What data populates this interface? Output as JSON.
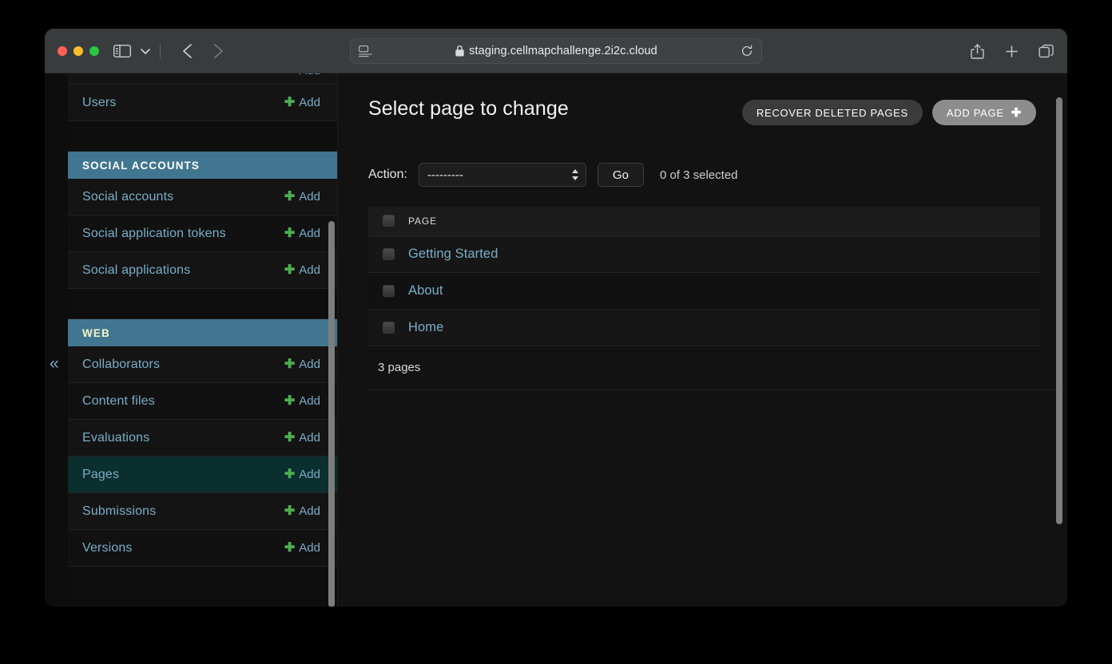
{
  "browser": {
    "url": "staging.cellmapchallenge.2i2c.cloud",
    "traffic_lights": [
      "close",
      "minimize",
      "zoom"
    ],
    "icons": {
      "sidebar_toggle": "sidebar-toggle-icon",
      "tab_group_chevron": "chevron-down-icon",
      "back": "back-arrow-icon",
      "forward": "forward-arrow-icon",
      "reader": "reader-view-icon",
      "lock": "lock-icon",
      "reload": "reload-icon",
      "share": "share-icon",
      "new_tab": "plus-icon",
      "tab_overview": "tab-overview-icon"
    }
  },
  "sidebar": {
    "collapse_glyph": "«",
    "partial_top_row": {
      "label": "",
      "add_label": "Add"
    },
    "blocks": [
      {
        "type": "item",
        "label": "Users",
        "add_label": "Add",
        "current": false
      },
      {
        "type": "gap"
      },
      {
        "type": "section",
        "label": "SOCIAL ACCOUNTS",
        "visited": false
      },
      {
        "type": "item",
        "label": "Social accounts",
        "add_label": "Add",
        "current": false
      },
      {
        "type": "item",
        "label": "Social application tokens",
        "add_label": "Add",
        "current": false
      },
      {
        "type": "item",
        "label": "Social applications",
        "add_label": "Add",
        "current": false
      },
      {
        "type": "gap"
      },
      {
        "type": "section",
        "label": "WEB",
        "visited": true
      },
      {
        "type": "item",
        "label": "Collaborators",
        "add_label": "Add",
        "current": false
      },
      {
        "type": "item",
        "label": "Content files",
        "add_label": "Add",
        "current": false
      },
      {
        "type": "item",
        "label": "Evaluations",
        "add_label": "Add",
        "current": false
      },
      {
        "type": "item",
        "label": "Pages",
        "add_label": "Add",
        "current": true
      },
      {
        "type": "item",
        "label": "Submissions",
        "add_label": "Add",
        "current": false
      },
      {
        "type": "item",
        "label": "Versions",
        "add_label": "Add",
        "current": false
      }
    ]
  },
  "main": {
    "title": "Select page to change",
    "recover_button": "RECOVER DELETED PAGES",
    "add_button": "ADD PAGE",
    "add_button_glyph": "✚",
    "action_label": "Action:",
    "action_selected": "---------",
    "action_options": [
      "---------"
    ],
    "go_button": "Go",
    "selection_count": "0 of 3 selected",
    "table": {
      "columns": [
        "PAGE"
      ],
      "rows": [
        {
          "page": "Getting Started"
        },
        {
          "page": "About"
        },
        {
          "page": "Home"
        }
      ]
    },
    "result_count": "3 pages"
  },
  "colors": {
    "link": "#79aec8",
    "section_header_bg": "#417690",
    "visited_link": "#f7f7c9",
    "add_plus": "#4caf50",
    "current_row_bg": "#0b2e2e",
    "add_button_bg": "#8d8d8d",
    "recover_button_bg": "#3b3b3b"
  }
}
